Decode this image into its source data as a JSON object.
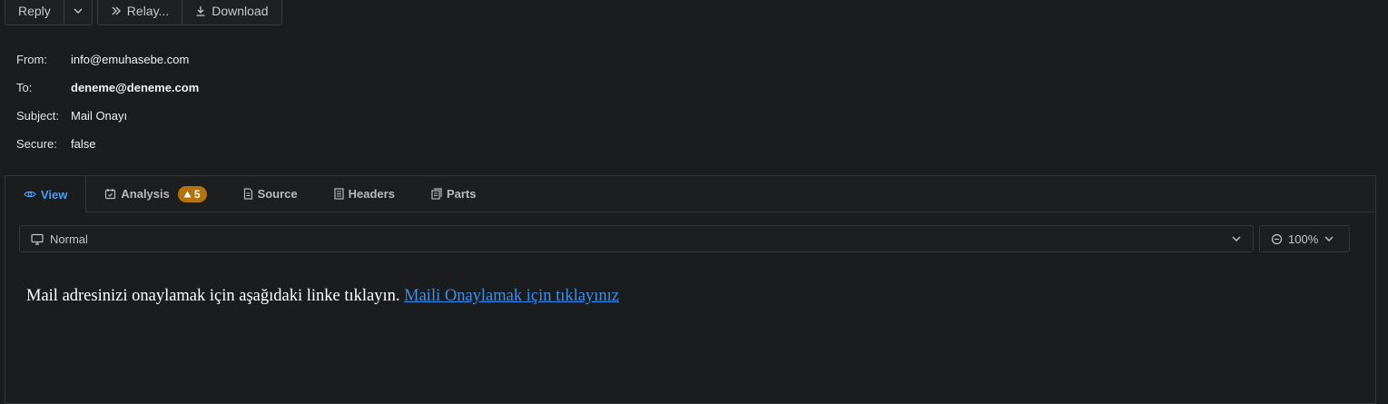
{
  "toolbar": {
    "reply_label": "Reply",
    "relay_label": "Relay...",
    "download_label": "Download"
  },
  "meta": {
    "from_label": "From:",
    "from_value": "info@emuhasebe.com",
    "to_label": "To:",
    "to_value": "deneme@deneme.com",
    "subject_label": "Subject:",
    "subject_value": "Mail Onayı",
    "secure_label": "Secure:",
    "secure_value": "false"
  },
  "tabs": {
    "view": "View",
    "analysis": "Analysis",
    "analysis_count": "5",
    "source": "Source",
    "headers": "Headers",
    "parts": "Parts"
  },
  "controls": {
    "view_mode": "Normal",
    "zoom": "100%"
  },
  "message": {
    "text": "Mail adresinizi onaylamak için aşağıdaki linke tıklayın.",
    "link_text": "Maili Onaylamak için tıklayınız"
  },
  "colors": {
    "background": "#1b1c1e",
    "active_tab": "#4c9bf0",
    "badge": "#b5730f",
    "link": "#3d8fe8"
  }
}
